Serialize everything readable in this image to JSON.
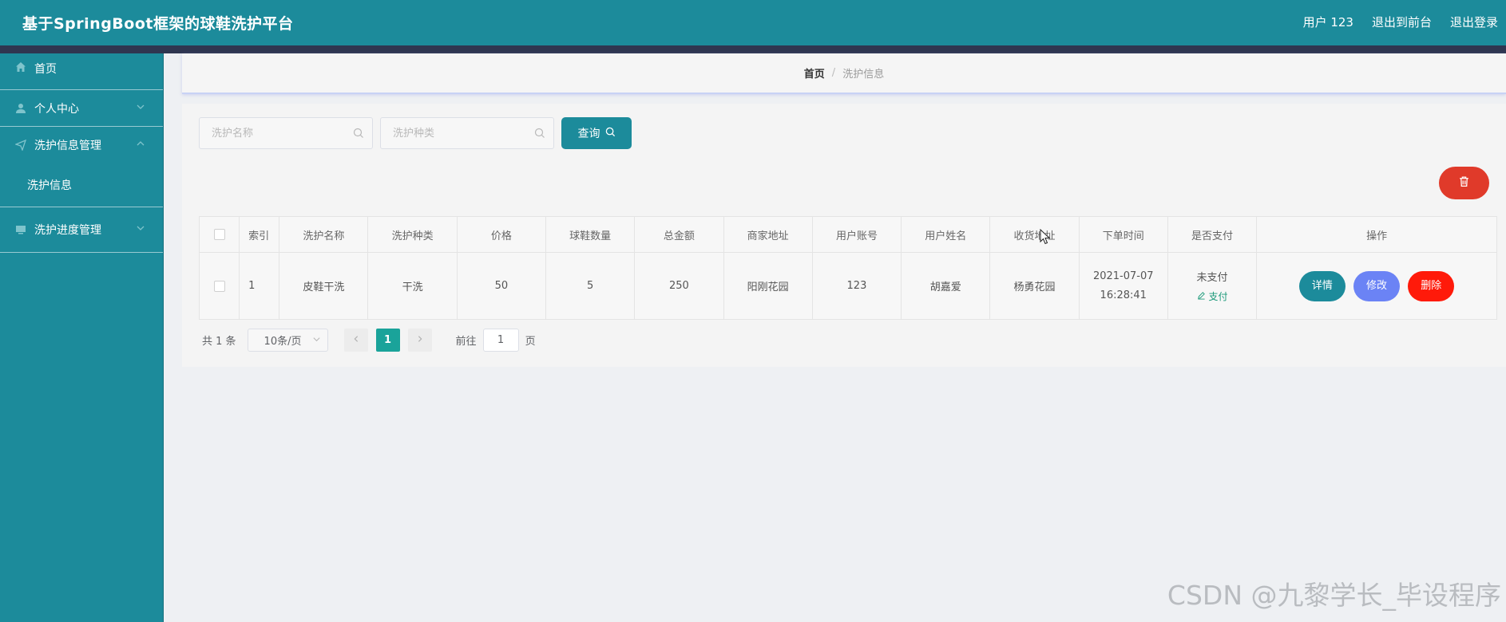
{
  "app": {
    "title": "基于SpringBoot框架的球鞋洗护平台",
    "user": "用户 123",
    "back_to_front": "退出到前台",
    "logout": "退出登录"
  },
  "sidebar": {
    "items": [
      {
        "label": "首页",
        "icon": "home-icon"
      },
      {
        "label": "个人中心",
        "icon": "user-icon",
        "expanded": false
      },
      {
        "label": "洗护信息管理",
        "icon": "send-icon",
        "expanded": true,
        "children": [
          "洗护信息"
        ]
      },
      {
        "label": "洗护进度管理",
        "icon": "monitor-icon",
        "expanded": false
      }
    ]
  },
  "breadcrumb": {
    "home": "首页",
    "separator": "/",
    "current": "洗护信息"
  },
  "search": {
    "name_placeholder": "洗护名称",
    "type_placeholder": "洗护种类",
    "query_label": "查询"
  },
  "table": {
    "headers": [
      "索引",
      "洗护名称",
      "洗护种类",
      "价格",
      "球鞋数量",
      "总金额",
      "商家地址",
      "用户账号",
      "用户姓名",
      "收货地址",
      "下单时间",
      "是否支付",
      "操作"
    ],
    "rows": [
      {
        "index": "1",
        "name": "皮鞋干洗",
        "type": "干洗",
        "price": "50",
        "quantity": "5",
        "total": "250",
        "merchant_address": "阳刚花园",
        "account": "123",
        "user_name": "胡嘉爱",
        "delivery_address": "杨勇花园",
        "order_date": "2021-07-07",
        "order_time": "16:28:41",
        "paid_status": "未支付",
        "pay_label": "支付",
        "actions": {
          "detail": "详情",
          "edit": "修改",
          "delete": "删除"
        }
      }
    ]
  },
  "pagination": {
    "total": "共 1 条",
    "page_size": "10条/页",
    "current_page": "1",
    "goto_label": "前往",
    "goto_value": "1",
    "page_unit": "页"
  },
  "colors": {
    "primary": "#1c8b9b",
    "danger": "#e03a2a",
    "edit": "#6b83f5",
    "pager_active": "#1aa39a"
  },
  "watermark": "CSDN @九黎学长_毕设程序"
}
